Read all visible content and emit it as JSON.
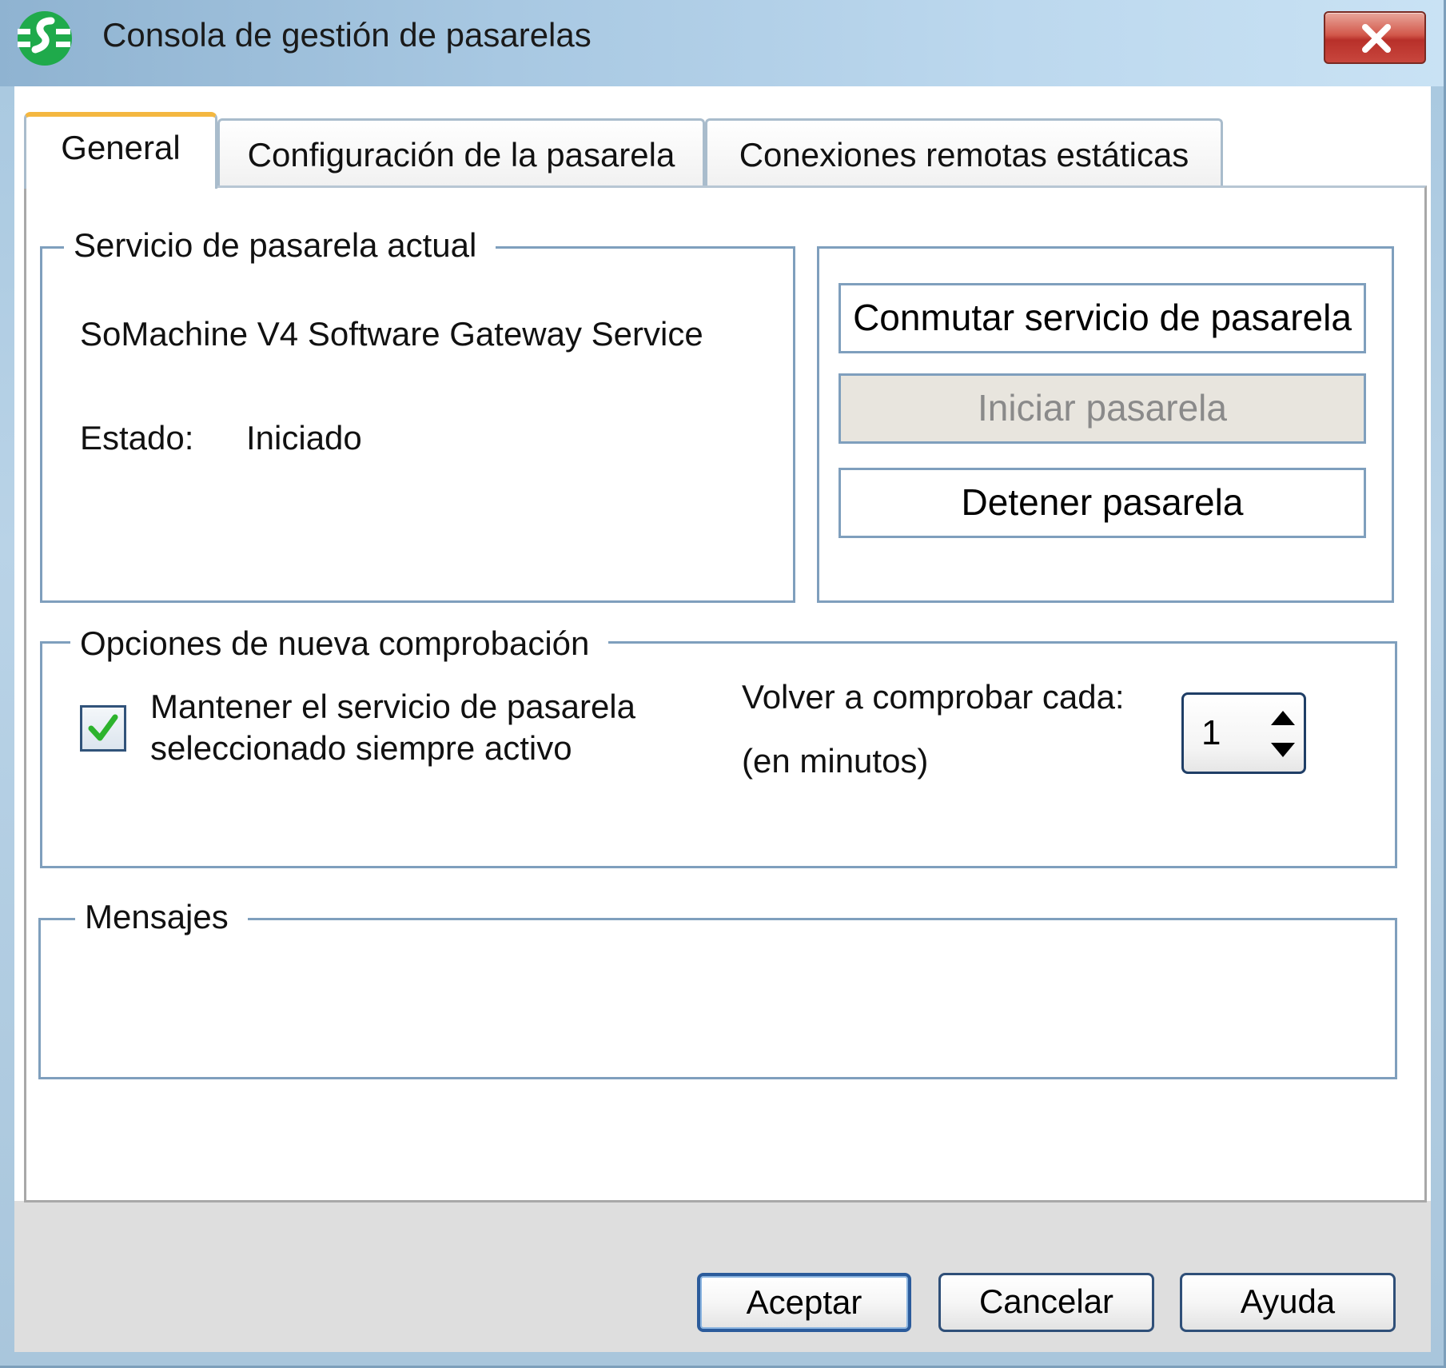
{
  "window": {
    "title": "Consola de gestión de pasarelas",
    "logo_icon": "schneider-electric-logo",
    "close_label": "X"
  },
  "tabs": [
    {
      "label": "General",
      "active": true
    },
    {
      "label": "Configuración de la pasarela",
      "active": false
    },
    {
      "label": "Conexiones remotas estáticas",
      "active": false
    }
  ],
  "current_service": {
    "group_label": "Servicio de pasarela actual",
    "service_name": "SoMachine V4 Software Gateway Service",
    "status_label": "Estado:",
    "status_value": "Iniciado"
  },
  "service_actions": {
    "switch_label": "Conmutar servicio de pasarela",
    "start_label": "Iniciar pasarela",
    "start_enabled": false,
    "stop_label": "Detener pasarela"
  },
  "recheck": {
    "group_label": "Opciones de nueva comprobación",
    "keep_active_line1": "Mantener el servicio de pasarela",
    "keep_active_line2": "seleccionado siempre activo",
    "keep_active_checked": true,
    "interval_label": "Volver a comprobar cada:",
    "interval_unit": "(en minutos)",
    "interval_value": "1"
  },
  "messages": {
    "group_label": "Mensajes"
  },
  "footer": {
    "ok_label": "Aceptar",
    "cancel_label": "Cancelar",
    "help_label": "Ayuda"
  },
  "colors": {
    "title_gradient_start": "#8fb3d1",
    "title_gradient_end": "#c9e2f4",
    "group_border": "#7f9fbd",
    "active_tab_accent": "#f4b740",
    "logo_green": "#1faa4b",
    "close_red": "#c8463d",
    "check_green": "#2db32d"
  }
}
